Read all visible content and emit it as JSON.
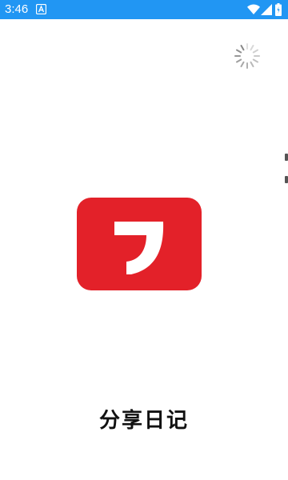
{
  "status_bar": {
    "time": "3:46",
    "background_color": "#2196f3",
    "icons": [
      "notification-a-icon",
      "wifi-icon",
      "signal-icon",
      "battery-icon"
    ]
  },
  "splash": {
    "app_name": "分享日记",
    "logo_color": "#e32129",
    "loading_spinner": "spinner-icon"
  }
}
